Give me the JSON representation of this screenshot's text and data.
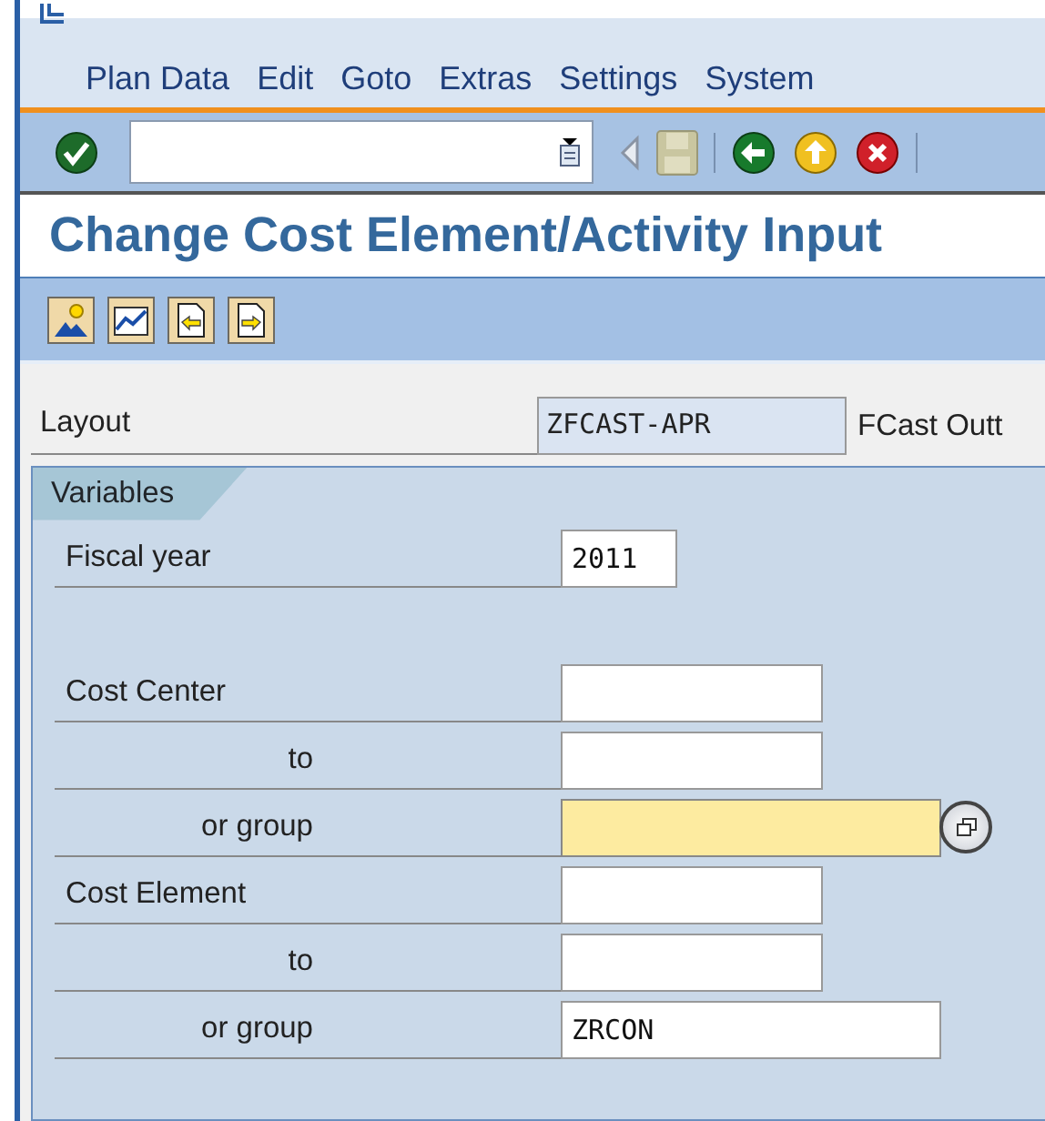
{
  "menu": [
    "Plan Data",
    "Edit",
    "Goto",
    "Extras",
    "Settings",
    "System"
  ],
  "title": "Change Cost Element/Activity Input",
  "layout": {
    "label": "Layout",
    "value": "ZFCAST-APR",
    "description": "FCast Outt"
  },
  "variables": {
    "tab": "Variables",
    "rows": [
      {
        "label": "Fiscal year",
        "kind": "year",
        "value": "2011",
        "focused": false,
        "value_help": false
      },
      {
        "kind": "blank"
      },
      {
        "label": "Cost Center",
        "kind": "from",
        "focused": false,
        "value_help": false
      },
      {
        "label": "to",
        "kind": "to",
        "focused": false,
        "value_help": false
      },
      {
        "label": "or group",
        "kind": "group",
        "focused": true,
        "value_help": true
      },
      {
        "label": "Cost Element",
        "kind": "from",
        "focused": false,
        "value_help": false
      },
      {
        "label": "to",
        "kind": "to",
        "focused": false,
        "value_help": false
      },
      {
        "label": "or group",
        "kind": "group",
        "value": "ZRCON",
        "focused": false,
        "value_help": false
      }
    ]
  }
}
